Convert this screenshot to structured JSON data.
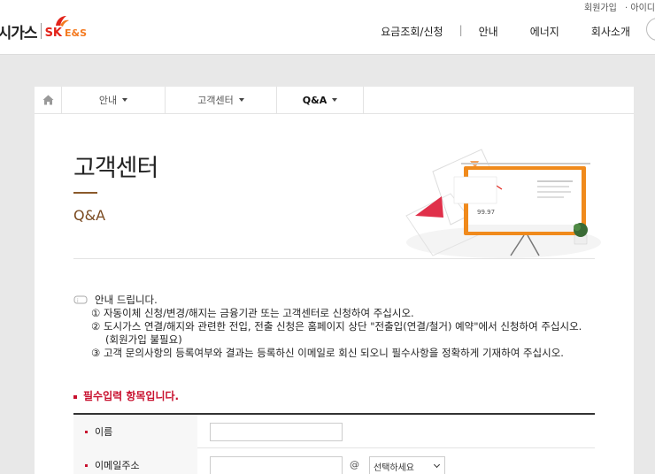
{
  "header": {
    "brand": "도시가스",
    "logo_sk": "SK",
    "logo_es": "E&S",
    "util_links": [
      "회원가입",
      "· 아이디"
    ],
    "gnb": [
      "요금조회/신청",
      "안내",
      "에너지",
      "회사소개"
    ],
    "gnb_divider": "|"
  },
  "breadcrumb": {
    "home_icon": "home-icon",
    "items": [
      {
        "label": "안내"
      },
      {
        "label": "고객센터"
      },
      {
        "label": "Q&A"
      }
    ]
  },
  "page": {
    "title": "고객센터",
    "subtitle": "Q&A"
  },
  "notice": {
    "heading": "안내 드립니다.",
    "lines": [
      "① 자동이체 신청/변경/해지는 금융기관 또는 고객센터로 신청하여 주십시오.",
      "② 도시가스 연결/해지와 관련한 전입, 전출 신청은 홈페이지 상단 \"전출입(연결/철거) 예약\"에서 신청하여 주십시오.",
      "(회원가입 불필요)",
      "③ 고객 문의사항의 등록여부와 결과는 등록하신 이메일로 회신 되오니 필수사항을 정확하게 기재하여 주십시오."
    ]
  },
  "required_note": "필수입력 항목입니다.",
  "form": {
    "name_label": "이름",
    "name_value": "",
    "email_label": "이메일주소",
    "email_value": "",
    "at_sign": "@",
    "domain_select": "선택하세요"
  },
  "colors": {
    "accent_red": "#c8102e",
    "brand_brown": "#7a4a20",
    "sk_red": "#e2231a",
    "sk_orange": "#f47a20"
  }
}
